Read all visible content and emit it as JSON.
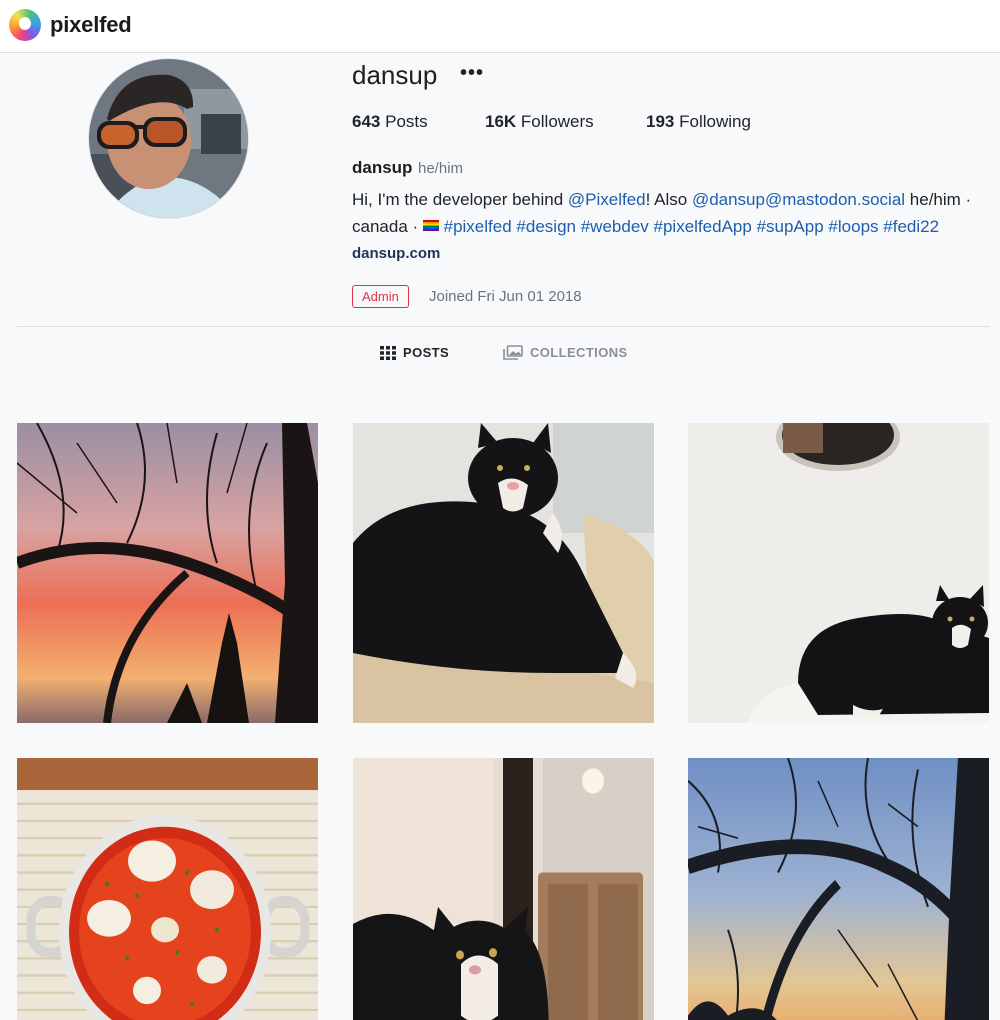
{
  "brand": {
    "name": "pixelfed",
    "icon": "pixelfed-logo-icon"
  },
  "profile": {
    "username": "dansup",
    "more_label": "•••",
    "stats": {
      "posts_count": "643",
      "posts_label": "Posts",
      "followers_count": "16K",
      "followers_label": "Followers",
      "following_count": "193",
      "following_label": "Following"
    },
    "display_name": "dansup",
    "pronouns": "he/him",
    "bio": {
      "intro": "Hi, I'm the developer behind ",
      "mention1": "@Pixelfed",
      "mid": "! Also ",
      "mention2": "@dansup@mastodon.social",
      "suffix1": " he/him ·",
      "line2_prefix": "canada · ",
      "flag_icon": "pride-flag-icon",
      "hashtags": [
        "#pixelfed",
        "#design",
        "#webdev",
        "#pixelfedApp",
        "#supApp",
        "#loops",
        "#fedi22"
      ]
    },
    "website": "dansup.com",
    "badge": "Admin",
    "joined": "Joined Fri Jun 01 2018"
  },
  "tabs": {
    "posts": {
      "label": "POSTS",
      "icon": "grid-icon"
    },
    "collections": {
      "label": "COLLECTIONS",
      "icon": "collections-icon"
    }
  },
  "colors": {
    "link": "#1d5fae",
    "admin": "#dc3545",
    "muted": "#6c757d"
  }
}
